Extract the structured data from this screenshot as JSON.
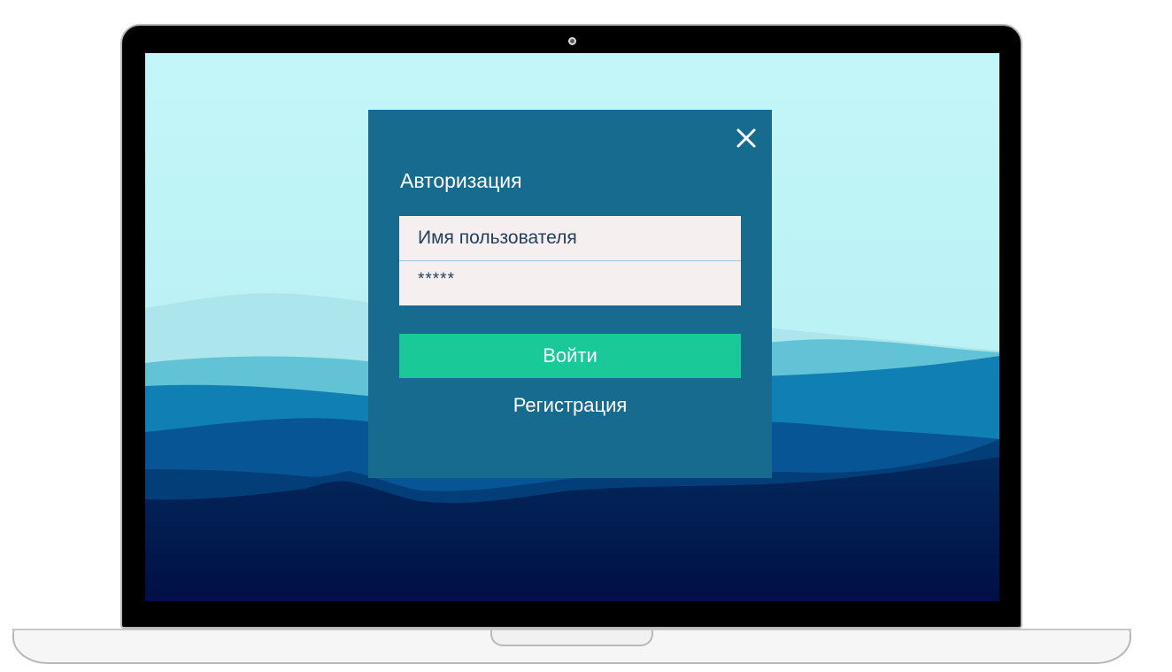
{
  "login_dialog": {
    "title": "Авторизация",
    "close_icon": "close-icon",
    "username": {
      "value": "Имя пользователя",
      "placeholder": "Имя пользователя"
    },
    "password": {
      "value": "*****"
    },
    "submit_label": "Войти",
    "register_label": "Регистрация"
  },
  "colors": {
    "dialog_background": "#166b8e",
    "button_background": "#19c998",
    "field_background": "#f6efef",
    "sky": "#bff5f7"
  }
}
